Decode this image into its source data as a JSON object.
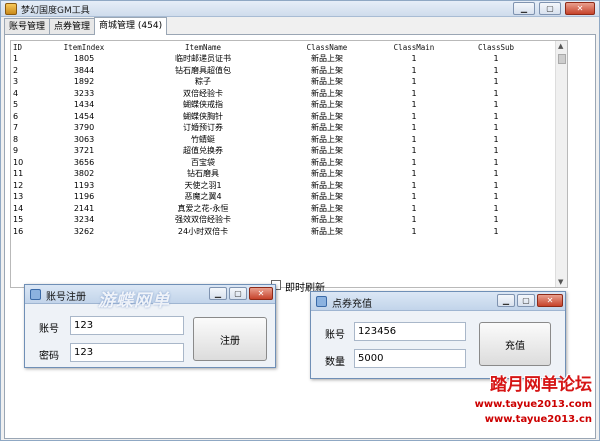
{
  "window": {
    "title": "梦幻国度GM工具"
  },
  "tabs": [
    {
      "label": "账号管理"
    },
    {
      "label": "点券管理"
    },
    {
      "label": "商城管理 (454)"
    }
  ],
  "table": {
    "columns": [
      "ID",
      "ItemIndex",
      "ItemName",
      "ClassName",
      "ClassMain",
      "ClassSub"
    ],
    "rows": [
      [
        "1",
        "1805",
        "临时邮递员证书",
        "新品上架",
        "1",
        "1"
      ],
      [
        "2",
        "3844",
        "钻石磨具超值包",
        "新品上架",
        "1",
        "1"
      ],
      [
        "3",
        "1892",
        "粽子",
        "新品上架",
        "1",
        "1"
      ],
      [
        "4",
        "3233",
        "双倍经验卡",
        "新品上架",
        "1",
        "1"
      ],
      [
        "5",
        "1434",
        "蝴蝶侠戒指",
        "新品上架",
        "1",
        "1"
      ],
      [
        "6",
        "1454",
        "蝴蝶侠胸针",
        "新品上架",
        "1",
        "1"
      ],
      [
        "7",
        "3790",
        "订婚预订券",
        "新品上架",
        "1",
        "1"
      ],
      [
        "8",
        "3063",
        "竹蜻蜓",
        "新品上架",
        "1",
        "1"
      ],
      [
        "9",
        "3721",
        "超值兑换券",
        "新品上架",
        "1",
        "1"
      ],
      [
        "10",
        "3656",
        "百宝袋",
        "新品上架",
        "1",
        "1"
      ],
      [
        "11",
        "3802",
        "钻石磨具",
        "新品上架",
        "1",
        "1"
      ],
      [
        "12",
        "1193",
        "天使之羽1",
        "新品上架",
        "1",
        "1"
      ],
      [
        "13",
        "1196",
        "恶魔之翼4",
        "新品上架",
        "1",
        "1"
      ],
      [
        "14",
        "2141",
        "真爱之花-永恒",
        "新品上架",
        "1",
        "1"
      ],
      [
        "15",
        "3234",
        "强效双倍经验卡",
        "新品上架",
        "1",
        "1"
      ],
      [
        "16",
        "3262",
        "24小时双倍卡",
        "新品上架",
        "1",
        "1"
      ]
    ]
  },
  "auto_refresh": {
    "label": "即时刷新",
    "checked": false
  },
  "register_dialog": {
    "title": "账号注册",
    "account_label": "账号",
    "account_value": "123",
    "password_label": "密码",
    "password_value": "123",
    "button": "注册"
  },
  "recharge_dialog": {
    "title": "点券充值",
    "account_label": "账号",
    "account_value": "123456",
    "amount_label": "数量",
    "amount_value": "5000",
    "button": "充值"
  },
  "watermark": "游蝶网单",
  "forum": {
    "name": "踏月网单论坛",
    "url1": "www.tayue2013.com",
    "url2": "www.tayue2013.cn"
  }
}
